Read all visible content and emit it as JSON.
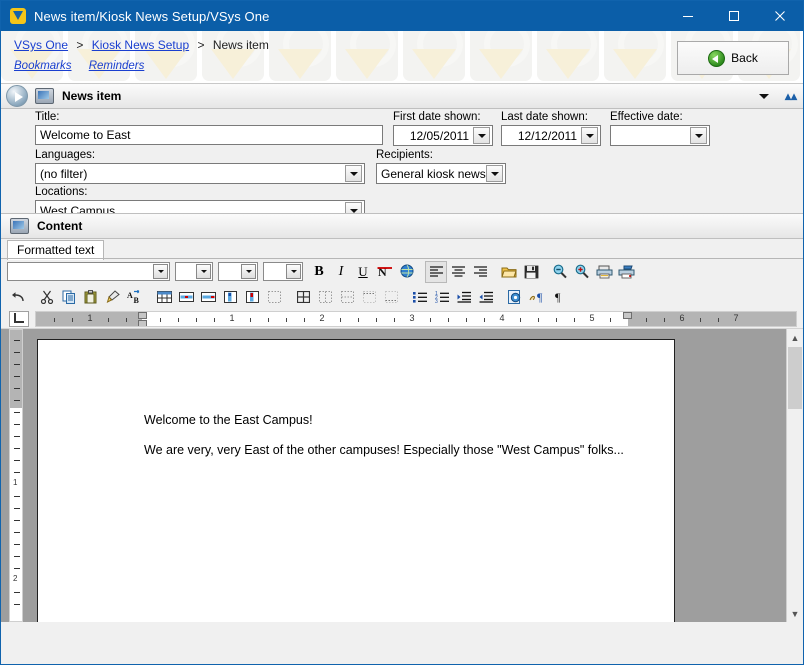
{
  "window": {
    "title": "News item/Kiosk News Setup/VSys One",
    "app_icon": "vsys-logo-icon",
    "controls": {
      "minimize": "minimize-icon",
      "maximize": "maximize-icon",
      "close": "close-icon"
    }
  },
  "breadcrumb": {
    "items": [
      {
        "label": "VSys One",
        "link": true
      },
      {
        "label": "Kiosk News Setup",
        "link": true
      },
      {
        "label": "News item",
        "link": false
      }
    ],
    "separator": ">"
  },
  "quicklinks": [
    {
      "label": "Bookmarks"
    },
    {
      "label": "Reminders"
    }
  ],
  "back_button": {
    "label": "Back",
    "icon": "back-arrow-icon"
  },
  "section": {
    "title": "News item",
    "icon": "kiosk-monitor-icon",
    "expand_icon": "caret-down-icon",
    "collapse_icon": "chevron-up-icon"
  },
  "form": {
    "title": {
      "label": "Title:",
      "value": "Welcome to East"
    },
    "first_date_shown": {
      "label": "First date shown:",
      "value": "12/05/2011"
    },
    "last_date_shown": {
      "label": "Last date shown:",
      "value": "12/12/2011"
    },
    "effective_date": {
      "label": "Effective date:",
      "value": ""
    },
    "languages": {
      "label": "Languages:",
      "value": "(no filter)"
    },
    "recipients": {
      "label": "Recipients:",
      "value": "General kiosk news"
    },
    "locations": {
      "label": "Locations:",
      "value": "West Campus"
    }
  },
  "content": {
    "title": "Content",
    "icon": "content-page-icon",
    "tabs": [
      {
        "label": "Formatted text",
        "active": true
      }
    ]
  },
  "editor": {
    "selects": [
      {
        "name": "font-family-select",
        "value": ""
      },
      {
        "name": "font-size-select",
        "value": ""
      },
      {
        "name": "style-select",
        "value": ""
      },
      {
        "name": "zoom-select",
        "value": ""
      }
    ],
    "toolbar_row1": [
      {
        "name": "bold-button",
        "glyph": "B",
        "kind": "bold"
      },
      {
        "name": "italic-button",
        "glyph": "I",
        "kind": "ital"
      },
      {
        "name": "underline-button",
        "glyph": "U",
        "kind": "und"
      },
      {
        "name": "strikethrough-button",
        "glyph": "N",
        "kind": "red"
      },
      {
        "name": "text-color-button",
        "glyph": "◕",
        "kind": "color"
      },
      {
        "name": "align-left-button",
        "glyph": "≡",
        "kind": "alignl",
        "selected": true
      },
      {
        "name": "align-center-button",
        "glyph": "≡",
        "kind": "alignc"
      },
      {
        "name": "align-right-button",
        "glyph": "≡",
        "kind": "alignr"
      },
      {
        "name": "open-file-button",
        "glyph": "📂",
        "kind": "folder"
      },
      {
        "name": "save-file-button",
        "glyph": "💾",
        "kind": "disk"
      },
      {
        "name": "zoom-out-button",
        "glyph": "⊖",
        "kind": "zoomout"
      },
      {
        "name": "zoom-in-button",
        "glyph": "⊕",
        "kind": "zoomin"
      },
      {
        "name": "print-button",
        "glyph": "🖨",
        "kind": "print"
      },
      {
        "name": "print-preview-button",
        "glyph": "🖨",
        "kind": "printprev"
      }
    ],
    "toolbar_row2": [
      {
        "name": "undo-button",
        "glyph": "↰",
        "kind": "undo"
      },
      {
        "name": "cut-button",
        "glyph": "✂",
        "kind": "cut"
      },
      {
        "name": "copy-button",
        "glyph": "❐",
        "kind": "copy"
      },
      {
        "name": "paste-button",
        "glyph": "📋",
        "kind": "paste"
      },
      {
        "name": "format-painter-button",
        "glyph": "🖌",
        "kind": "brush"
      },
      {
        "name": "find-replace-button",
        "glyph": "A",
        "kind": "replace"
      },
      {
        "name": "insert-table-button",
        "glyph": "▦",
        "kind": "table"
      },
      {
        "name": "insert-row-button",
        "glyph": "▤",
        "kind": "rowins"
      },
      {
        "name": "delete-row-button",
        "glyph": "▤",
        "kind": "rowdel"
      },
      {
        "name": "insert-column-button",
        "glyph": "▥",
        "kind": "colins"
      },
      {
        "name": "delete-column-button",
        "glyph": "▥",
        "kind": "coldel"
      },
      {
        "name": "merge-cells-button",
        "glyph": "▢",
        "kind": "merge"
      },
      {
        "name": "table-borders-all-button",
        "glyph": "⊞",
        "kind": "ball"
      },
      {
        "name": "table-borders-outer-button",
        "glyph": "▢",
        "kind": "bout"
      },
      {
        "name": "table-borders-inner-button",
        "glyph": "▢",
        "kind": "binner"
      },
      {
        "name": "table-borders-top-button",
        "glyph": "▢",
        "kind": "btop"
      },
      {
        "name": "table-borders-none-button",
        "glyph": "▢",
        "kind": "bnone"
      },
      {
        "name": "bullet-list-button",
        "glyph": "≔",
        "kind": "bullets"
      },
      {
        "name": "numbered-list-button",
        "glyph": "≔",
        "kind": "numbers"
      },
      {
        "name": "increase-indent-button",
        "glyph": "⇥",
        "kind": "indentin"
      },
      {
        "name": "decrease-indent-button",
        "glyph": "⇤",
        "kind": "indentout"
      },
      {
        "name": "insert-object-button",
        "glyph": "◉",
        "kind": "object"
      },
      {
        "name": "insert-field-button",
        "glyph": "¶",
        "kind": "fieldins"
      },
      {
        "name": "show-paragraph-marks-button",
        "glyph": "¶",
        "kind": "pilcrow"
      }
    ]
  },
  "ruler": {
    "corner_icon": "tab-stop-icon",
    "h_numbers": [
      "1",
      "1",
      "2",
      "3",
      "4",
      "5",
      "6",
      "7"
    ],
    "v_numbers": [
      "1",
      "2"
    ],
    "left_margin_marker": "left-indent-marker",
    "right_margin_marker": "right-indent-marker"
  },
  "document": {
    "paragraphs": [
      "Welcome to the East Campus!",
      "We are very, very East of the other campuses! Especially those \"West Campus\" folks..."
    ]
  },
  "scrollbar": {
    "up_icon": "scroll-up-icon",
    "down_icon": "scroll-down-icon"
  },
  "colors": {
    "titlebar": "#0b5ea8",
    "link": "#1a3fcf",
    "face": "#f0f0f0",
    "doc_backdrop": "#9e9e9e"
  }
}
